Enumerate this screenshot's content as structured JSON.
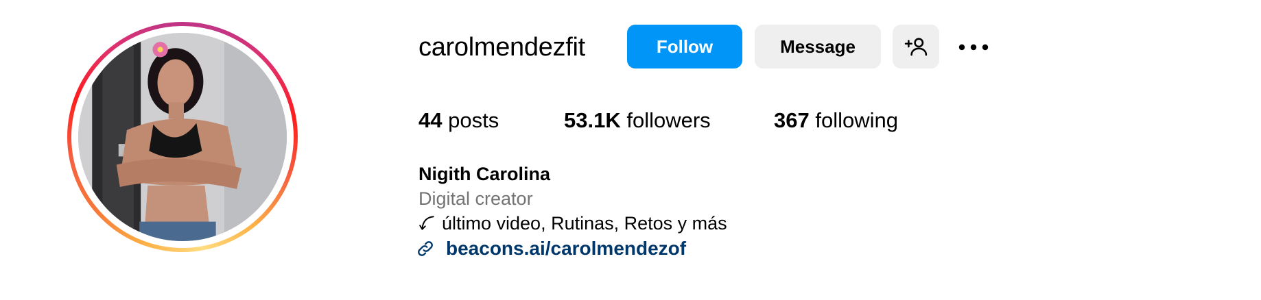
{
  "profile": {
    "username": "carolmendezfit",
    "full_name": "Nigith Carolina",
    "category": "Digital creator",
    "bio": "último video, Rutinas, Retos y más",
    "link": "beacons.ai/carolmendezof",
    "has_story_ring": true
  },
  "actions": {
    "follow_label": "Follow",
    "message_label": "Message",
    "suggest_icon": "add-person-icon",
    "more_icon": "more-options-icon"
  },
  "stats": {
    "posts_count": "44",
    "posts_label": "posts",
    "followers_count": "53.1K",
    "followers_label": "followers",
    "following_count": "367",
    "following_label": "following"
  },
  "colors": {
    "follow_button": "#0095f6",
    "secondary_button": "#efefef",
    "link": "#00376b",
    "muted_text": "#737373",
    "story_ring_gradient": [
      "#fcaf45",
      "#f77737",
      "#fd1d1d",
      "#e1306c",
      "#c13584"
    ]
  }
}
